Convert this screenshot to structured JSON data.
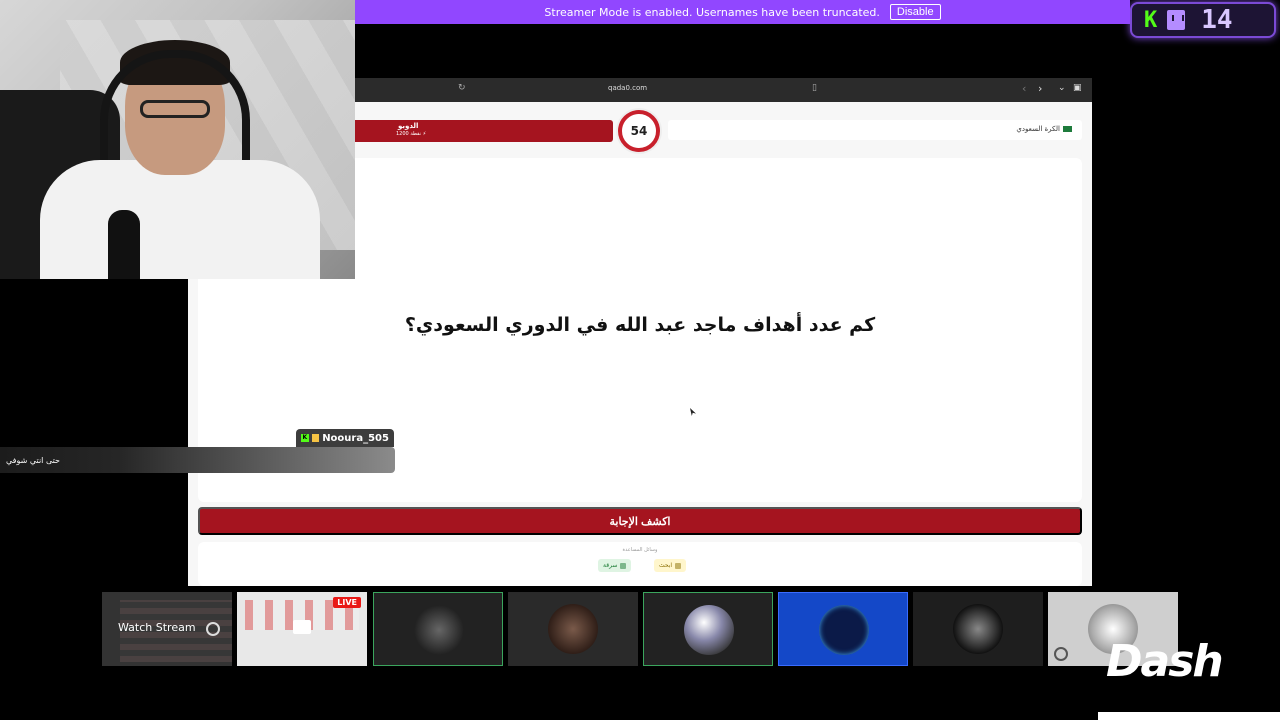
{
  "streamer_banner": {
    "message": "Streamer Mode is enabled. Usernames have been truncated.",
    "disable_label": "Disable"
  },
  "counter": {
    "value": "14",
    "kick_letter": "K"
  },
  "browser": {
    "url": "qada0.com"
  },
  "game": {
    "team_name": "الدوبو",
    "team_points": "1200 نقطة ⚡",
    "timer": "54",
    "category": "الكرة السعودي",
    "question": "كم عدد أهداف ماجد عبد الله في الدوري السعودي؟",
    "reveal_label": "اكشف الإجابة",
    "helpers_title": "وسائل المساعدة",
    "helper_steal": "سرقة",
    "helper_search": "ابحث"
  },
  "chat": {
    "username": "Nooura_505",
    "message": "حتى انتي شوفي",
    "kick_badge": "K"
  },
  "thumbnails": {
    "watch_label": "Watch Stream",
    "live_label": "LIVE"
  },
  "logo": {
    "text": "Dash"
  },
  "colors": {
    "twitch_purple": "#9147ff",
    "kick_green": "#53fc18",
    "game_red": "#a5141f"
  }
}
